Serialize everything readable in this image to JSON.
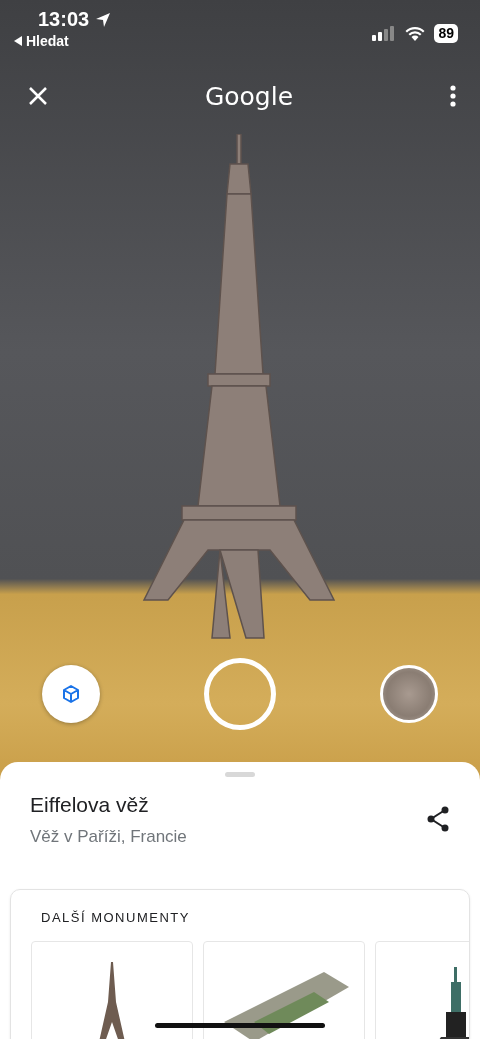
{
  "status_bar": {
    "time": "13:03",
    "back_label": "Hledat",
    "battery": "89"
  },
  "top_bar": {
    "title": "Google"
  },
  "sheet": {
    "title": "Eiffelova věž",
    "subtitle": "Věž v Paříži, Francie",
    "section": {
      "title": "DALŠÍ MONUMENTY"
    }
  }
}
